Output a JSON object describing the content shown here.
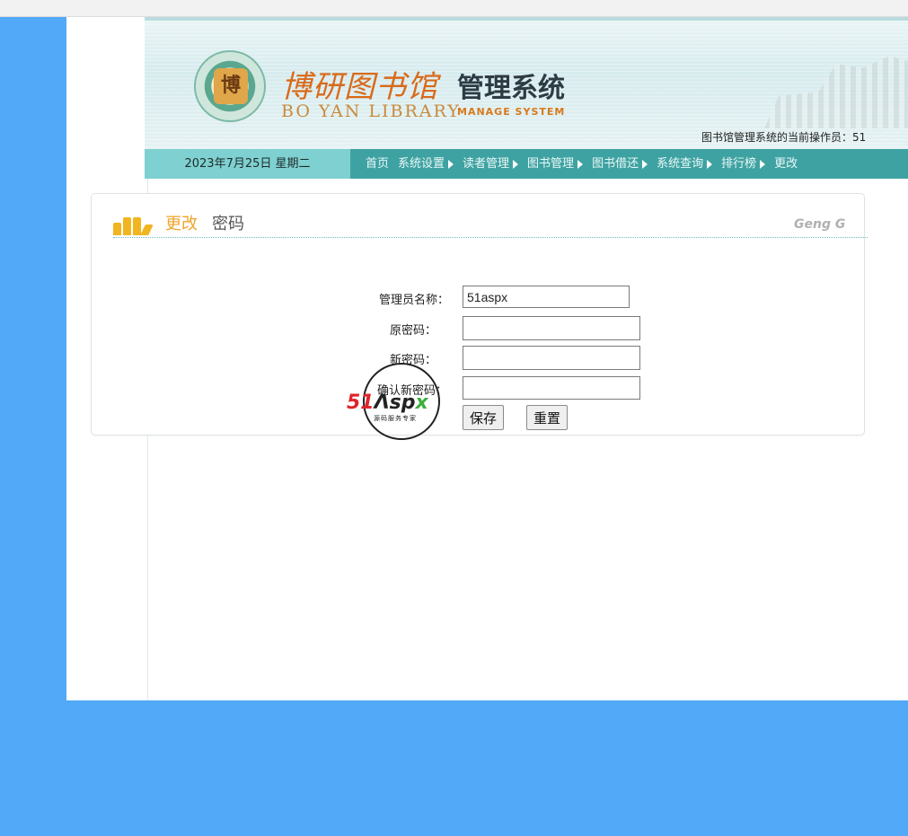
{
  "header": {
    "logo_cn": "博研图书馆",
    "logo_cn_system": "管理系统",
    "logo_en": "BO YAN LIBRARY",
    "logo_en_system": "MANAGE SYSTEM",
    "seal_char": "博",
    "operator_text": "图书馆管理系统的当前操作员：51"
  },
  "nav": {
    "date": "2023年7月25日 星期二",
    "items": [
      {
        "label": "首页",
        "has_arrow": false
      },
      {
        "label": "系统设置",
        "has_arrow": true
      },
      {
        "label": "读者管理",
        "has_arrow": true
      },
      {
        "label": "图书管理",
        "has_arrow": true
      },
      {
        "label": "图书借还",
        "has_arrow": true
      },
      {
        "label": "系统查询",
        "has_arrow": true
      },
      {
        "label": "排行榜",
        "has_arrow": true
      },
      {
        "label": "更改",
        "has_arrow": false
      }
    ]
  },
  "panel": {
    "title_highlight": "更改",
    "title_rest": "密码",
    "pinyin": "Geng G"
  },
  "form": {
    "admin_label": "管理员名称：",
    "admin_value": "51aspx",
    "old_pwd_label": "原密码：",
    "new_pwd_label": "新密码：",
    "confirm_pwd_label": "确认新密码：",
    "save_label": "保存",
    "reset_label": "重置"
  },
  "watermark": {
    "brand_51": "51",
    "brand_a": "Λ",
    "brand_sp": "sp",
    "brand_x": "x",
    "tagline": "源码服务专家"
  },
  "colors": {
    "background": "#52a9f7",
    "nav_bar": "#3fa2a2",
    "date_box": "#7fd0d0",
    "accent_orange": "#f0a42a"
  }
}
